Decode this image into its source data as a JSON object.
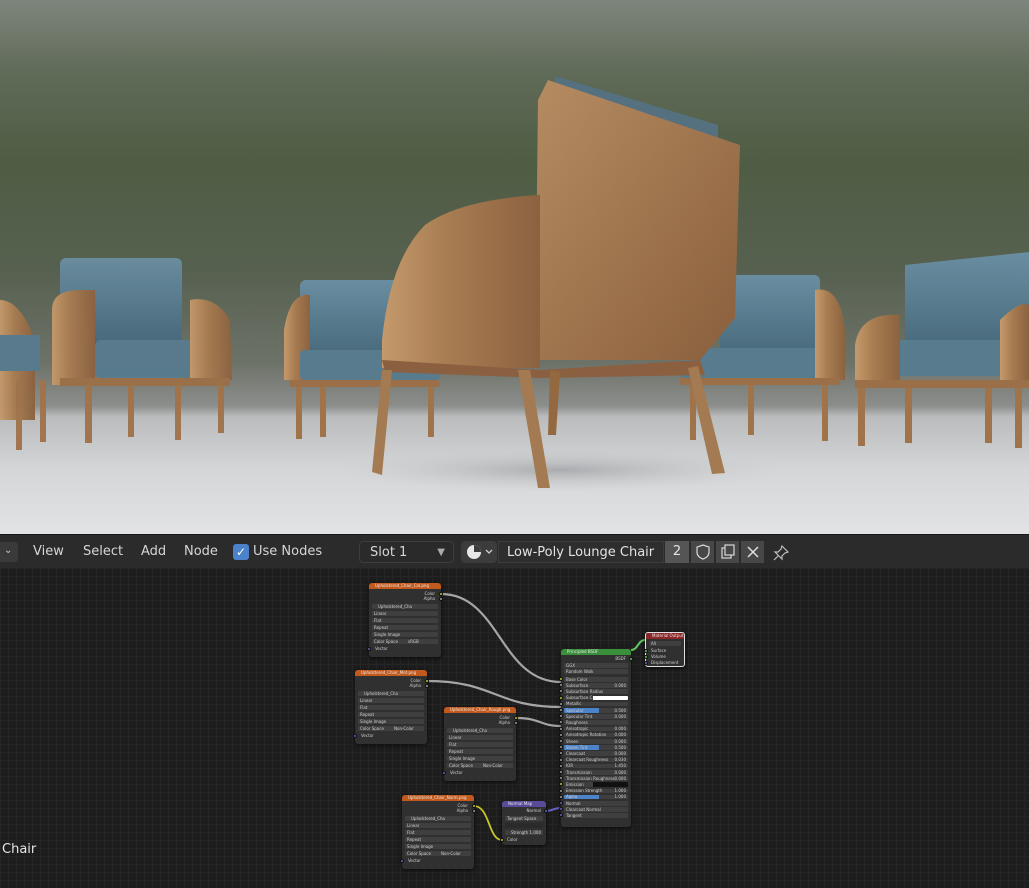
{
  "header": {
    "menus": [
      "View",
      "Select",
      "Add",
      "Node"
    ],
    "use_nodes_label": "Use Nodes",
    "slot_value": "Slot 1",
    "material_name": "Low-Poly Lounge Chair",
    "user_count": "2"
  },
  "nodes": {
    "tex1": {
      "title": "Upholstered_Chair_Col.png",
      "out_color": "Color",
      "out_alpha": "Alpha",
      "image": "Upholstered_Cha",
      "interp": "Linear",
      "proj": "Flat",
      "ext": "Repeat",
      "source": "Single Image",
      "colorspace_label": "Color Space",
      "colorspace_value": "sRGB",
      "vector": "Vector"
    },
    "tex2": {
      "title": "Upholstered_Chair_Met.png",
      "out_color": "Color",
      "out_alpha": "Alpha",
      "image": "Upholstered_Cha",
      "interp": "Linear",
      "proj": "Flat",
      "ext": "Repeat",
      "source": "Single Image",
      "colorspace_label": "Color Space",
      "colorspace_value": "Non-Color",
      "vector": "Vector"
    },
    "tex3": {
      "title": "Upholstered_Chair_Rough.png",
      "out_color": "Color",
      "out_alpha": "Alpha",
      "image": "Upholstered_Cha",
      "interp": "Linear",
      "proj": "Flat",
      "ext": "Repeat",
      "source": "Single Image",
      "colorspace_label": "Color Space",
      "colorspace_value": "Non-Color",
      "vector": "Vector"
    },
    "tex4": {
      "title": "Upholstered_Chair_Norm.png",
      "out_color": "Color",
      "out_alpha": "Alpha",
      "image": "Upholstered_Cha",
      "interp": "Linear",
      "proj": "Flat",
      "ext": "Repeat",
      "source": "Single Image",
      "colorspace_label": "Color Space",
      "colorspace_value": "Non-Color",
      "vector": "Vector"
    },
    "normalmap": {
      "title": "Normal Map",
      "out": "Normal",
      "space": "Tangent Space",
      "strength_label": "Strength",
      "strength_value": "1.000",
      "color": "Color"
    },
    "bsdf": {
      "title": "Principled BSDF",
      "out": "BSDF",
      "distribution": "GGX",
      "subsurface_method": "Random Walk",
      "inputs": [
        {
          "label": "Base Color",
          "value": ""
        },
        {
          "label": "Subsurface",
          "value": "0.000"
        },
        {
          "label": "Subsurface Radius",
          "value": ""
        },
        {
          "label": "Subsurface C...",
          "value": ""
        },
        {
          "label": "Metallic",
          "value": ""
        },
        {
          "label": "Specular",
          "value": "0.500"
        },
        {
          "label": "Specular Tint",
          "value": "0.000"
        },
        {
          "label": "Roughness",
          "value": ""
        },
        {
          "label": "Anisotropic",
          "value": "0.000"
        },
        {
          "label": "Anisotropic Rotation",
          "value": "0.000"
        },
        {
          "label": "Sheen",
          "value": "0.000"
        },
        {
          "label": "Sheen Tint",
          "value": "0.500"
        },
        {
          "label": "Clearcoat",
          "value": "0.000"
        },
        {
          "label": "Clearcoat Roughness",
          "value": "0.030"
        },
        {
          "label": "IOR",
          "value": "1.450"
        },
        {
          "label": "Transmission",
          "value": "0.000"
        },
        {
          "label": "Transmission Roughness",
          "value": "0.000"
        },
        {
          "label": "Emission",
          "value": ""
        },
        {
          "label": "Emission Strength",
          "value": "1.000"
        },
        {
          "label": "Alpha",
          "value": "1.000"
        },
        {
          "label": "Normal",
          "value": ""
        },
        {
          "label": "Clearcoat Normal",
          "value": ""
        },
        {
          "label": "Tangent",
          "value": ""
        }
      ]
    },
    "output": {
      "title": "Material Output",
      "target": "All",
      "inputs": [
        "Surface",
        "Volume",
        "Displacement"
      ]
    }
  },
  "object_label": "Chair",
  "colors": {
    "texture_header": "#c25a1e",
    "bsdf_header": "#3a8f3a",
    "output_header": "#8d2626",
    "normalmap_header": "#5a4a9a",
    "accent": "#4b82c9"
  }
}
